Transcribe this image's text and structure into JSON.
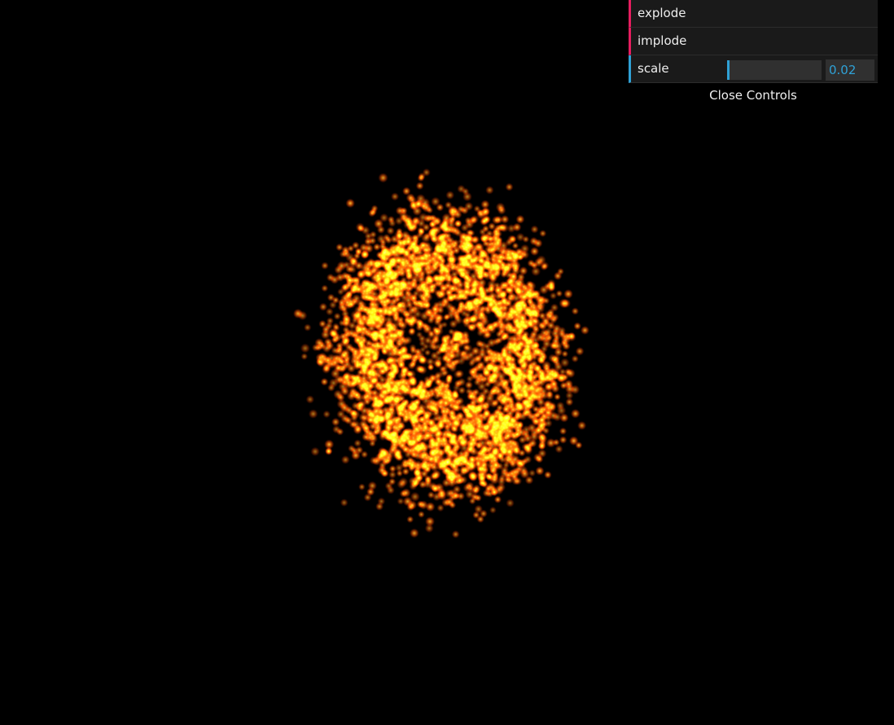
{
  "controls": {
    "explode_label": "explode",
    "implode_label": "implode",
    "scale_label": "scale",
    "scale_value": "0.02",
    "scale_fraction": 0.02,
    "close_label": "Close Controls"
  },
  "colors": {
    "background": "#000000",
    "panel_background": "#1a1a1a",
    "function_accent": "#e61d5f",
    "number_accent": "#2fa1d6",
    "particle_core": "#ffd23a",
    "particle_glow": "#ff4a00"
  }
}
